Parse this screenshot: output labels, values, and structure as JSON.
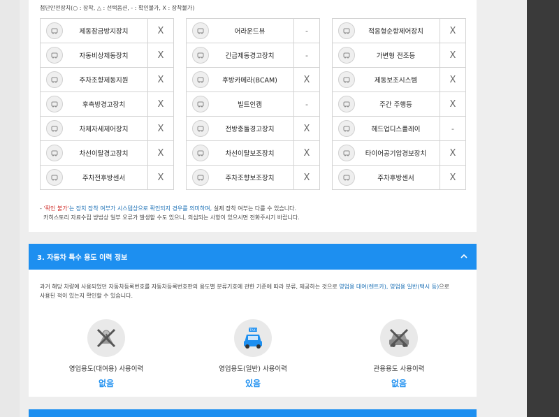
{
  "legend_text": "첨단안전장치(○ : 장착, △ : 선택옵션, - : 확인불가, X : 장착불가)",
  "columns": [
    [
      {
        "icon": "abs-icon",
        "name": "제동잠금방지장치",
        "value": "X"
      },
      {
        "icon": "emergency-brake-icon",
        "name": "자동비상제동장치",
        "value": "X"
      },
      {
        "icon": "steering-assist-icon",
        "name": "주차조향제동지원",
        "value": "X"
      },
      {
        "icon": "rear-side-warning-icon",
        "name": "후측방경고장치",
        "value": "X"
      },
      {
        "icon": "stability-control-icon",
        "name": "차체자세제어장치",
        "value": "X"
      },
      {
        "icon": "lane-departure-icon",
        "name": "차선이탈경고장치",
        "value": "X"
      },
      {
        "icon": "parking-sensor-icon",
        "name": "주차전후방센서",
        "value": "X"
      }
    ],
    [
      {
        "icon": "around-view-icon",
        "name": "어라운드뷰",
        "value": "-"
      },
      {
        "icon": "emergency-stop-signal-icon",
        "name": "긴급제동경고장치",
        "value": "-"
      },
      {
        "icon": "rear-camera-icon",
        "name": "후방카메라(BCAM)",
        "value": "X"
      },
      {
        "icon": "built-in-cam-icon",
        "name": "빌트인캠",
        "value": "-"
      },
      {
        "icon": "front-collision-icon",
        "name": "전방충돌경고장치",
        "value": "X"
      },
      {
        "icon": "lane-keeping-icon",
        "name": "차선이탈보조장치",
        "value": "X"
      },
      {
        "icon": "parking-steering-icon",
        "name": "주차조향보조장치",
        "value": "X"
      }
    ],
    [
      {
        "icon": "cruise-control-icon",
        "name": "적응형순항제어장치",
        "value": "X"
      },
      {
        "icon": "adaptive-headlamp-icon",
        "name": "가변형 전조등",
        "value": "X"
      },
      {
        "icon": "brake-assist-icon",
        "name": "제동보조시스템",
        "value": "X"
      },
      {
        "icon": "daytime-light-icon",
        "name": "주간 주행등",
        "value": "X"
      },
      {
        "icon": "hud-icon",
        "name": "헤드업디스플레이",
        "value": "-"
      },
      {
        "icon": "tire-pressure-icon",
        "name": "타이어공기압경보장치",
        "value": "X"
      },
      {
        "icon": "rear-sensor-icon",
        "name": "주차후방센서",
        "value": "X"
      }
    ]
  ],
  "notes": {
    "line1_prefix": "- ",
    "line1_highlight_red": "'확인 불가'",
    "line1_highlight_blue": "는 장치 장착 여부가 시스템상으로 확인되지 경우를 의미하며,",
    "line1_rest": " 실제 장착 여부는 다를 수 있습니다.",
    "line2": "카히스토리 자료수집 방법상 일부 오류가 발생할 수도 있으니, 의심되는 사항이 있으시면 전화주시기 바랍니다."
  },
  "section3": {
    "title": "3. 자동차 특수 용도 이력 정보",
    "desc_part1": "과거 해당 차량에 사용되었던 자동차등록번호를 자동차등록번호판의 용도별 분류기호에 관한 기준에 따라 분류, 제공하는 것으로 ",
    "desc_blue": "영업용 대여(렌트카), 영업용 일반(택시 등)",
    "desc_part2": "으로",
    "desc_line2": "사용된 적이 있는지 확인할 수 있습니다.",
    "items": [
      {
        "label": "영업용도(대여용) 사용이력",
        "value": "없음"
      },
      {
        "label": "영업용도(일반) 사용이력",
        "value": "있음"
      },
      {
        "label": "관용용도 사용이력",
        "value": "없음"
      }
    ],
    "taxi_text": "TAXI"
  },
  "colors": {
    "accent": "#1d8ff0",
    "border": "#d3d3d3"
  }
}
